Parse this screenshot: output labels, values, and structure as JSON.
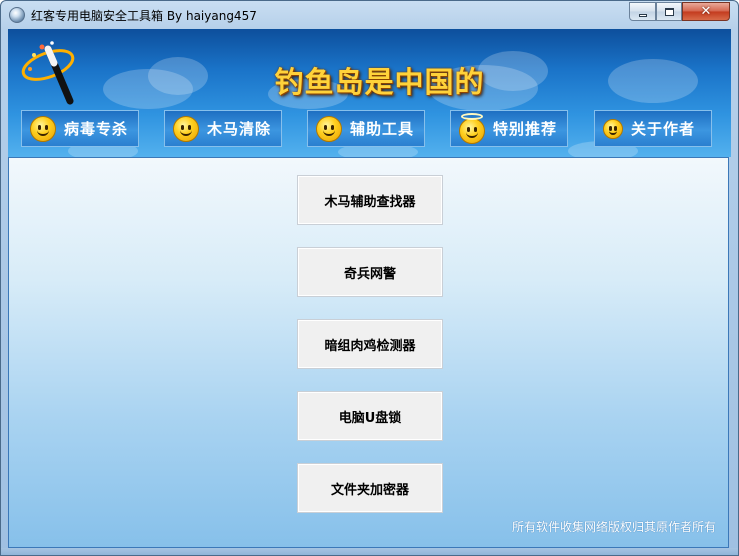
{
  "window": {
    "title": "红客专用电脑安全工具箱  By haiyang457",
    "controls": {
      "close_glyph": "✕"
    }
  },
  "banner": {
    "title": "钓鱼岛是中国的"
  },
  "tabs": [
    {
      "label": "病毒专杀",
      "icon": "smiley-icon"
    },
    {
      "label": "木马清除",
      "icon": "tongue-smiley-icon"
    },
    {
      "label": "辅助工具",
      "icon": "smiley-icon"
    },
    {
      "label": "特别推荐",
      "icon": "angel-smiley-icon"
    },
    {
      "label": "关于作者",
      "icon": "small-smiley-icon"
    }
  ],
  "tools": [
    {
      "label": "木马辅助查找器"
    },
    {
      "label": "奇兵网警"
    },
    {
      "label": "暗组肉鸡检测器"
    },
    {
      "label": "电脑U盘锁"
    },
    {
      "label": "文件夹加密器"
    }
  ],
  "footer": {
    "text": "所有软件收集网络版权归其原作者所有"
  },
  "colors": {
    "banner_top": "#0d4f9c",
    "banner_bottom": "#53b1ee",
    "title_gold": "#ffd23a",
    "content_bottom": "#86c0ea"
  }
}
